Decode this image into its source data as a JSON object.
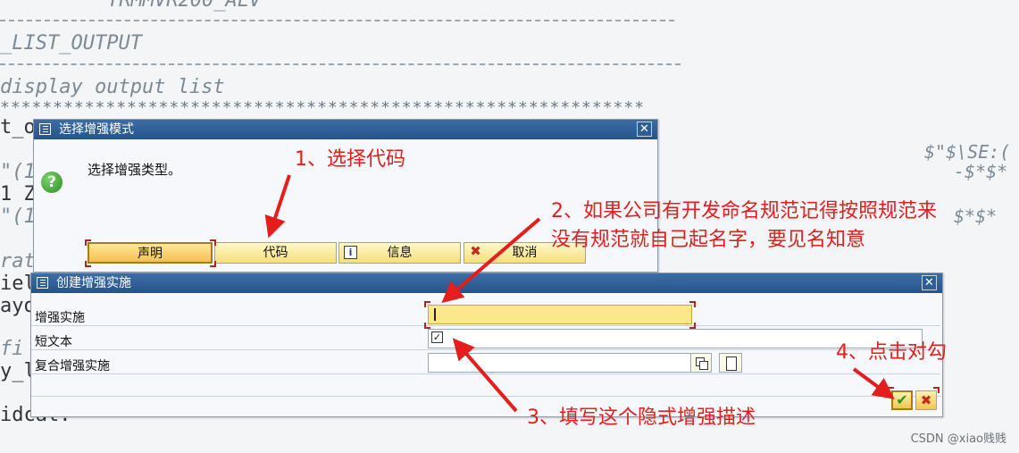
{
  "background_code": {
    "lines": [
      "TRMMVR200_ALV",
      "_LIST_OUTPUT",
      "display output list",
      "t_ou",
      "\"(1)-",
      "1  Z",
      "\"(1)-",
      "rati",
      "iel",
      "ayou",
      "fi",
      "y_l",
      "idcat."
    ],
    "right_snippets": [
      "$\"$\\SE:(",
      "-$*$*",
      "$*$*"
    ],
    "star_row": "*************************************************************"
  },
  "dialog_select": {
    "title": "选择增强模式",
    "message": "选择增强类型。",
    "buttons": {
      "declaration": "声明",
      "code": "代码",
      "info": "信息",
      "cancel": "取消"
    }
  },
  "dialog_create": {
    "title": "创建增强实施",
    "fields": {
      "implementation_label": "增强实施",
      "implementation_value": "",
      "short_text_label": "短文本",
      "short_text_value": "",
      "composite_label": "复合增强实施",
      "composite_value": ""
    }
  },
  "annotations": {
    "step1": "1、选择代码",
    "step2_line1": "2、如果公司有开发命名规范记得按照规范来",
    "step2_line2": "没有规范就自己起名字，要见名知意",
    "step3": "3、填写这个隐式增强描述",
    "step4": "4、点击对勾",
    "color": "#e41d1d"
  },
  "watermark": "CSDN @xiao贱贱"
}
